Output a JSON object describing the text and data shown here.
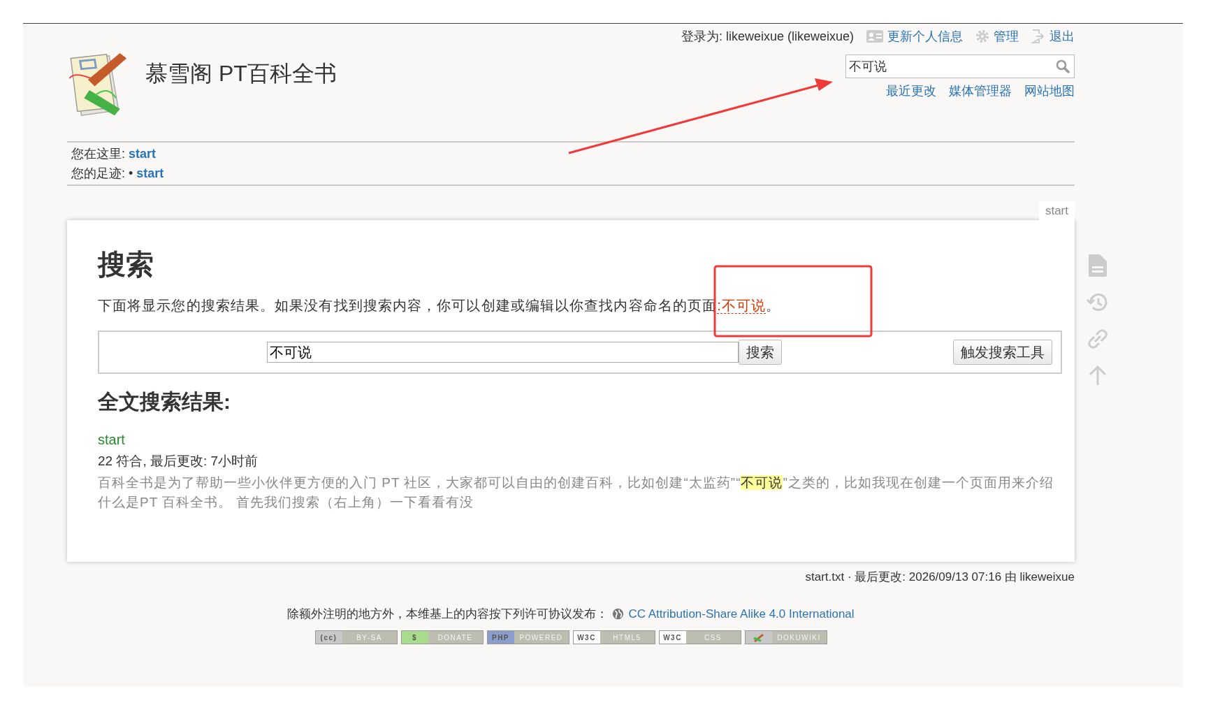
{
  "user_bar": {
    "login": "登录为: likeweixue (likeweixue)",
    "links": [
      {
        "kind": "profile",
        "label": "更新个人信息"
      },
      {
        "kind": "admin",
        "label": "管理"
      },
      {
        "kind": "logout",
        "label": "退出"
      }
    ]
  },
  "site_title": "慕雪阁 PT百科全书",
  "search": {
    "value": "不可说"
  },
  "site_links": [
    "最近更改",
    "媒体管理器",
    "网站地图"
  ],
  "breadcrumbs": [
    {
      "label": "您在这里:",
      "link": "start"
    },
    {
      "label": "您的足迹:",
      "bullet": "•",
      "link": "start"
    }
  ],
  "page_tab": "start",
  "content": {
    "heading": "搜索",
    "intro": "下面将显示您的搜索结果。如果没有找到搜索内容，你可以创建或编辑以你查找内容命名的页面",
    "intro_link": ":不可说",
    "intro_end": "。",
    "form": {
      "value": "不可说",
      "search_button": "搜索",
      "tools_button": "触发搜索工具"
    },
    "results_heading": "全文搜索结果:",
    "results": [
      {
        "title": "start",
        "meta": "22 符合, 最后更改: 7小时前",
        "snippet_before": "百科全书是为了帮助一些小伙伴更方便的入门 PT 社区，大家都可以自由的创建百科，比如创建“太监药”“",
        "highlight": "不可说",
        "snippet_after": "”之类的，比如我现在创建一个页面用来介绍什么是PT 百科全书。 首先我们搜索（右上角）一下看看有没"
      }
    ]
  },
  "page_info": "start.txt · 最后更改: 2026/09/13 07:16 由 likeweixue",
  "license": {
    "text": "除额外注明的地方外，本维基上的内容按下列许可协议发布：",
    "link": "CC Attribution-Share Alike 4.0 International"
  },
  "badges": [
    {
      "mark": "(cc)",
      "label": "BY-SA",
      "color": "#c8c8c8"
    },
    {
      "mark": "$",
      "label": "DONATE",
      "color": "#a8dc8c"
    },
    {
      "mark": "PHP",
      "label": "POWERED",
      "color": "#8c9ccc"
    },
    {
      "mark": "W3C",
      "label": "HTML5",
      "color": "#ffffff"
    },
    {
      "mark": "W3C",
      "label": "CSS",
      "color": "#ffffff"
    },
    {
      "label": "DOKUWIKI",
      "color": "#c8c8c8"
    }
  ]
}
